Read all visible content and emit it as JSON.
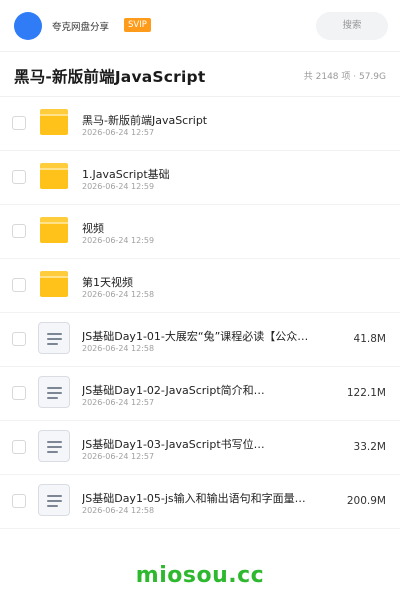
{
  "header": {
    "user_name": "夸克网盘分享",
    "badge": "SVIP",
    "search_label": "搜索"
  },
  "share": {
    "title": "黑马-新版前端JavaScript",
    "summary": "共 2148 项 · 57.9G"
  },
  "items": [
    {
      "type": "folder",
      "name": "黑马-新版前端JavaScript",
      "date": "2026-06-24 12:57",
      "size": ""
    },
    {
      "type": "folder",
      "name": "1.JavaScript基础",
      "date": "2026-06-24 12:59",
      "size": ""
    },
    {
      "type": "folder",
      "name": "视频",
      "date": "2026-06-24 12:59",
      "size": ""
    },
    {
      "type": "folder",
      "name": "第1天视频",
      "date": "2026-06-24 12:58",
      "size": ""
    },
    {
      "type": "file",
      "name": "JS基础Day1-01-大展宏“兔”课程必读【公众…",
      "date": "2026-06-24 12:58",
      "size": "41.8M"
    },
    {
      "type": "file",
      "name": "JS基础Day1-02-JavaScript简介和…",
      "date": "2026-06-24 12:57",
      "size": "122.1M"
    },
    {
      "type": "file",
      "name": "JS基础Day1-03-JavaScript书写位…",
      "date": "2026-06-24 12:57",
      "size": "33.2M"
    },
    {
      "type": "file",
      "name": "JS基础Day1-05-js输入和输出语句和字面量…",
      "date": "2026-06-24 12:58",
      "size": "200.9M"
    }
  ],
  "watermark": "miosou.cc",
  "colors": {
    "accent": "#2f7cf6",
    "badge": "#ff9b1a",
    "folder": "#ffc21a",
    "watermark": "#2eb82e"
  }
}
